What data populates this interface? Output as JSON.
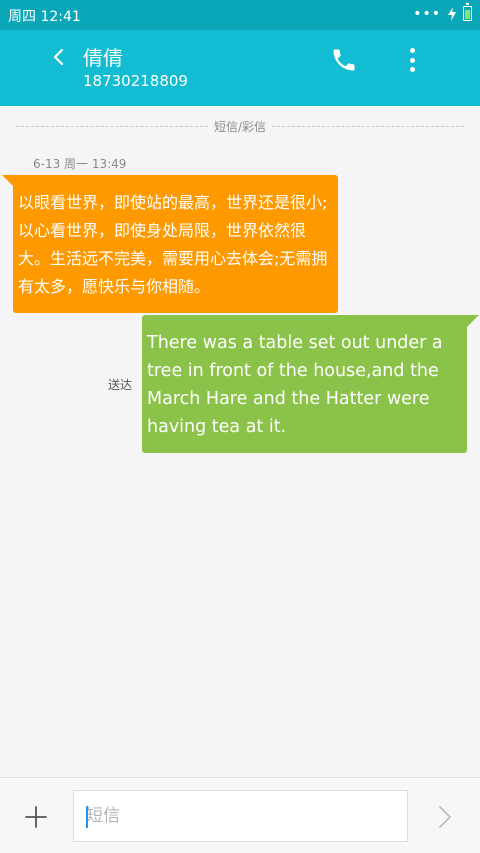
{
  "status_bar": {
    "time": "周四 12:41",
    "dots": "•••",
    "battery_level": 0.7
  },
  "header": {
    "back_icon": "chevron-left-icon",
    "contact_name": "倩倩",
    "contact_number": "18730218809",
    "call_icon": "phone-icon",
    "more_icon": "more-vertical-icon"
  },
  "thread": {
    "divider_label": "短信/彩信",
    "timestamp": "6-13 周一 13:49",
    "messages": [
      {
        "direction": "incoming",
        "color": "#ff9900",
        "text": "以眼看世界，即使站的最高，世界还是很小;以心看世界，即使身处局限，世界依然很大。生活远不完美，需要用心去体会;无需拥有太多，愿快乐与你相随。"
      },
      {
        "direction": "outgoing",
        "color": "#8bc34a",
        "text": "There was a table set out under a tree in front of the house,and the March Hare and the Hatter were having tea at it.",
        "status": "送达"
      }
    ]
  },
  "composer": {
    "add_icon": "plus-icon",
    "placeholder": "短信",
    "value": "",
    "send_icon": "chevron-right-icon"
  },
  "colors": {
    "status_bar": "#0aa7b8",
    "app_bar": "#12bcd2",
    "background": "#f5f5f5"
  }
}
